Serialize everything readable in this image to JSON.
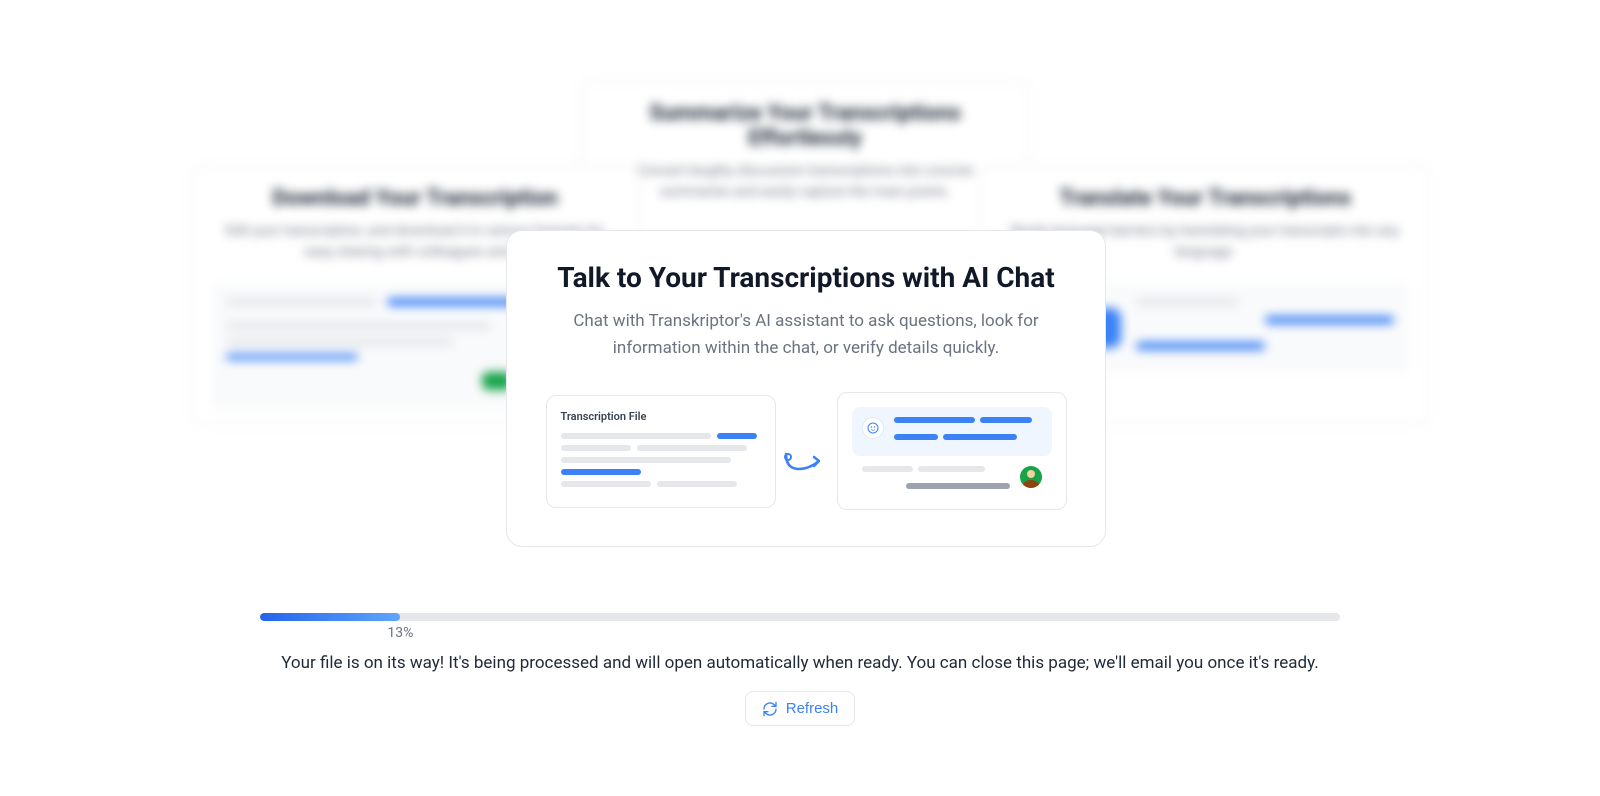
{
  "background_cards": {
    "left": {
      "title": "Download Your Transcription",
      "subtitle": "Edit your transcription, and download it in various formats for easy sharing with colleagues and ..."
    },
    "top": {
      "title": "Summarize Your Transcriptions Effortlessly",
      "subtitle": "Convert lengthy discussion transcriptions into concise summaries and easily capture the main points."
    },
    "right": {
      "title": "Translate Your Transcriptions",
      "subtitle": "Break language barriers by translating your transcripts into any language."
    }
  },
  "main_card": {
    "title": "Talk to Your Transcriptions with AI Chat",
    "subtitle": "Chat with Transkriptor's AI assistant to ask questions, look for information within the chat, or verify details quickly.",
    "illustration_label": "Transcription File"
  },
  "progress": {
    "percent": 13,
    "percent_label": "13%",
    "status": "Your file is on its way! It's being processed and will open automatically when ready. You can close this page; we'll email you once it's ready.",
    "refresh_label": "Refresh"
  }
}
